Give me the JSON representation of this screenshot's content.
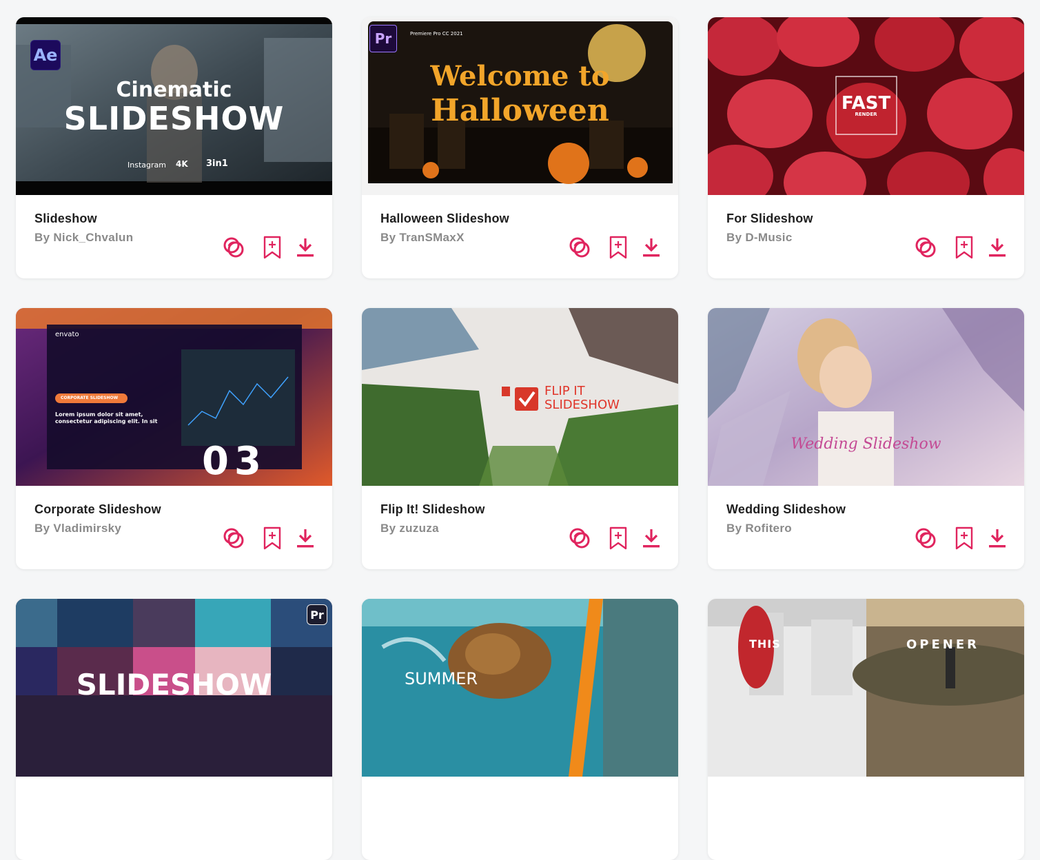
{
  "colors": {
    "accent": "#e0245e",
    "title": "#1f1f1f",
    "author": "#8a8a8a"
  },
  "icons": {
    "action_1": "brand-logo-icon",
    "action_2": "bookmark-add-icon",
    "action_3": "download-icon"
  },
  "cards": [
    {
      "title": "Slideshow",
      "author": "By Nick_Chvalun",
      "thumb_heading": "Cinematic",
      "thumb_main": "SLIDESHOW",
      "badge": "Ae",
      "thumb_foot_1": "Instagram",
      "thumb_foot_2": "4K",
      "thumb_foot_3": "3in1"
    },
    {
      "title": "Halloween Slideshow",
      "author": "By TranSMaxX",
      "thumb_heading": "Welcome to",
      "thumb_main": "Halloween",
      "badge": "Pr",
      "thumb_small": "Premiere Pro CC 2021"
    },
    {
      "title": "For Slideshow",
      "author": "By D-Music",
      "thumb_main": "FAST",
      "thumb_sub": "RENDER"
    },
    {
      "title": "Corporate Slideshow",
      "author": "By Vladimirsky",
      "thumb_brand": "envato",
      "thumb_tag": "CORPORATE SLIDESHOW",
      "thumb_body": "Lorem ipsum dolor sit amet, consectetur adipiscing elit. In sit",
      "thumb_number": "03"
    },
    {
      "title": "Flip It! Slideshow",
      "author": "By zuzuza",
      "thumb_main": "FLIP IT",
      "thumb_sub": "SLIDESHOW"
    },
    {
      "title": "Wedding Slideshow",
      "author": "By Rofitero",
      "thumb_main": "Wedding Slideshow"
    },
    {
      "thumb_main": "SLIDESHOW",
      "badge": "Pr"
    },
    {
      "thumb_main": "SUMMER"
    },
    {
      "thumb_main": "THIS",
      "thumb_sub": "OPENER"
    }
  ]
}
